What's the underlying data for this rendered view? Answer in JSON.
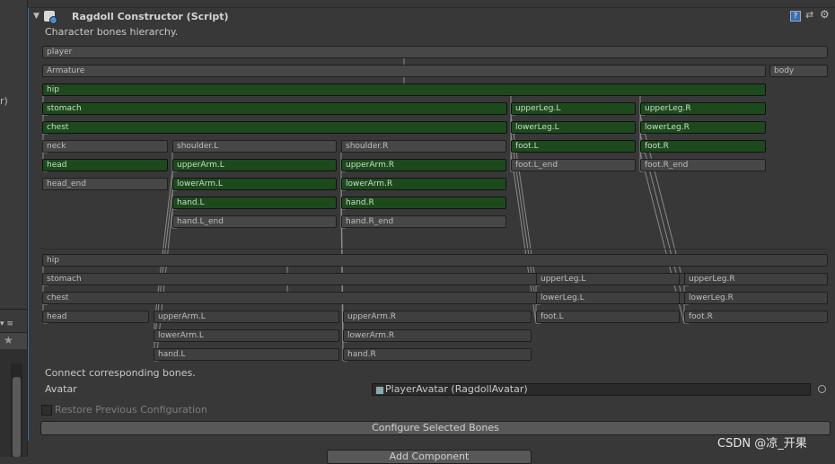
{
  "left": {
    "fragment": "r)",
    "tools": "▾ ≡"
  },
  "component": {
    "title": "Ragdoll Constructor (Script)",
    "hierarchy_label": "Character bones hierarchy.",
    "connect_label": "Connect corresponding bones.",
    "avatar_label": "Avatar",
    "avatar_value": "PlayerAvatar (RagdollAvatar)",
    "restore_label": "Restore Previous Configuration",
    "configure_button": "Configure Selected Bones",
    "add_component_button": "Add Component"
  },
  "bones": {
    "player": "player",
    "armature": "Armature",
    "body": "body",
    "hip": "hip",
    "stomach": "stomach",
    "chest": "chest",
    "neck": "neck",
    "head": "head",
    "head_end": "head_end",
    "shoulder_l": "shoulder.L",
    "upperarm_l": "upperArm.L",
    "lowerarm_l": "lowerArm.L",
    "hand_l": "hand.L",
    "hand_l_end": "hand.L_end",
    "shoulder_r": "shoulder.R",
    "upperarm_r": "upperArm.R",
    "lowerarm_r": "lowerArm.R",
    "hand_r": "hand.R",
    "hand_r_end": "hand.R_end",
    "upperleg_l": "upperLeg.L",
    "lowerleg_l": "lowerLeg.L",
    "foot_l": "foot.L",
    "foot_l_end": "foot.L_end",
    "upperleg_r": "upperLeg.R",
    "lowerleg_r": "lowerLeg.R",
    "foot_r": "foot.R",
    "foot_r_end": "foot.R_end"
  },
  "watermark": "CSDN @凉_开果",
  "colors": {
    "selected_bone": "#1d4a1d",
    "frame_accent": "#3d6fa6"
  }
}
